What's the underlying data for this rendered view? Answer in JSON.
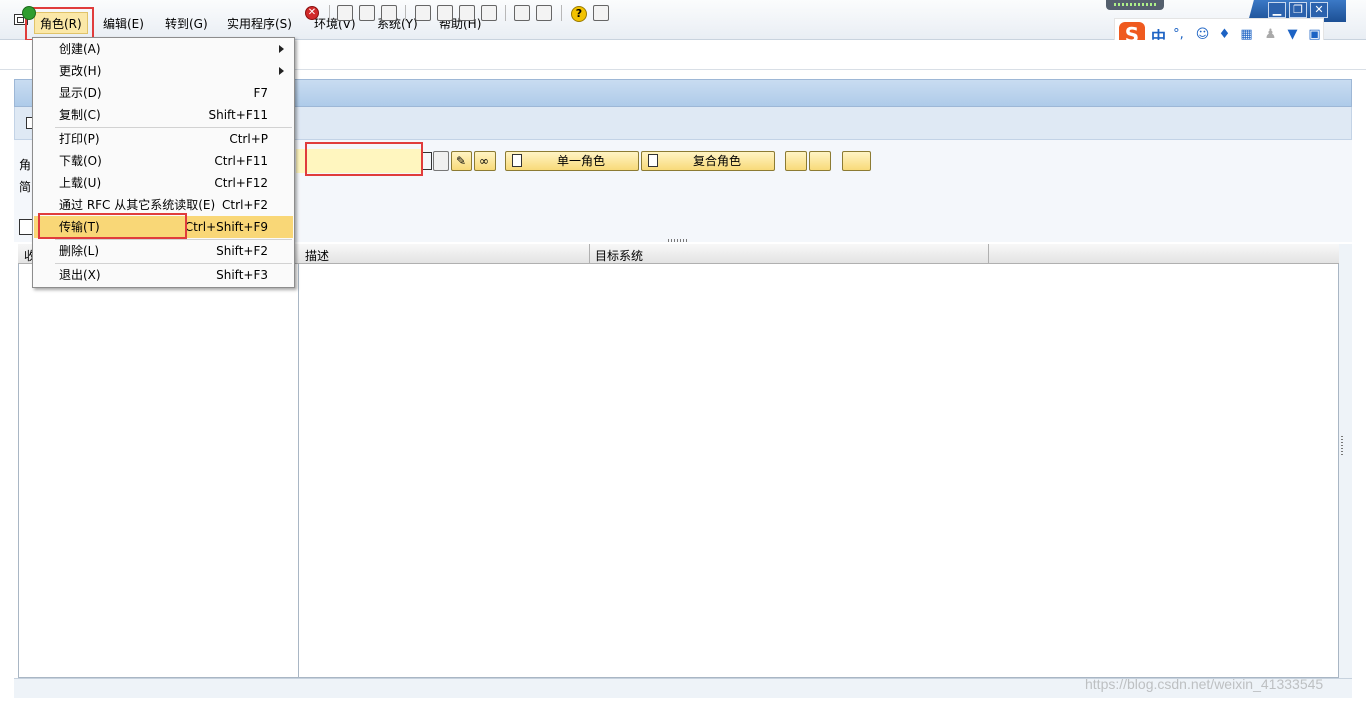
{
  "menubar": {
    "items": [
      {
        "id": "role",
        "label": "角色(R)"
      },
      {
        "id": "edit",
        "label": "编辑(E)"
      },
      {
        "id": "goto",
        "label": "转到(G)"
      },
      {
        "id": "util",
        "label": "实用程序(S)"
      },
      {
        "id": "env",
        "label": "环境(V)"
      },
      {
        "id": "sys",
        "label": "系统(Y)"
      },
      {
        "id": "help",
        "label": "帮助(H)"
      }
    ]
  },
  "window_controls": {
    "minimize": "▁",
    "maximize": "❐",
    "close": "✕"
  },
  "ime": {
    "logo": "S",
    "mode": "中",
    "icons": [
      "punct-icon",
      "emoji-icon",
      "mic-icon",
      "keyboard-icon",
      "user-icon",
      "skin-icon",
      "grid-icon"
    ]
  },
  "role_menu": {
    "items": [
      {
        "label": "创建(A)",
        "shortcut": "",
        "submenu": true
      },
      {
        "label": "更改(H)",
        "shortcut": "",
        "submenu": true
      },
      {
        "label": "显示(D)",
        "shortcut": "F7",
        "submenu": false
      },
      {
        "label": "复制(C)",
        "shortcut": "Shift+F11",
        "submenu": false
      },
      {
        "label": "打印(P)",
        "shortcut": "Ctrl+P",
        "submenu": false
      },
      {
        "label": "下载(O)",
        "shortcut": "Ctrl+F11",
        "submenu": false
      },
      {
        "label": "上载(U)",
        "shortcut": "Ctrl+F12",
        "submenu": false
      },
      {
        "label": "通过 RFC 从其它系统读取(E)",
        "shortcut": "Ctrl+F2",
        "submenu": false
      },
      {
        "label": "传输(T)",
        "shortcut": "Ctrl+Shift+F9",
        "submenu": false,
        "highlighted": true
      },
      {
        "label": "删除(L)",
        "shortcut": "Shift+F2",
        "submenu": false
      },
      {
        "label": "退出(X)",
        "shortcut": "Shift+F3",
        "submenu": false
      }
    ]
  },
  "selection": {
    "role_label": "角",
    "short_label": "简",
    "role_value": "",
    "single_role_button": "单一角色",
    "composite_role_button": "复合角色"
  },
  "lower_pane": {
    "left_header": "收",
    "columns": [
      "描述",
      "目标系统"
    ]
  },
  "watermark": "https://blog.csdn.net/weixin_41333545",
  "colors": {
    "accent_yellow": "#f8da7a",
    "highlight_red": "#e03c3c",
    "title_band": "#aecbe9",
    "menu_highlight": "#f9d777"
  }
}
